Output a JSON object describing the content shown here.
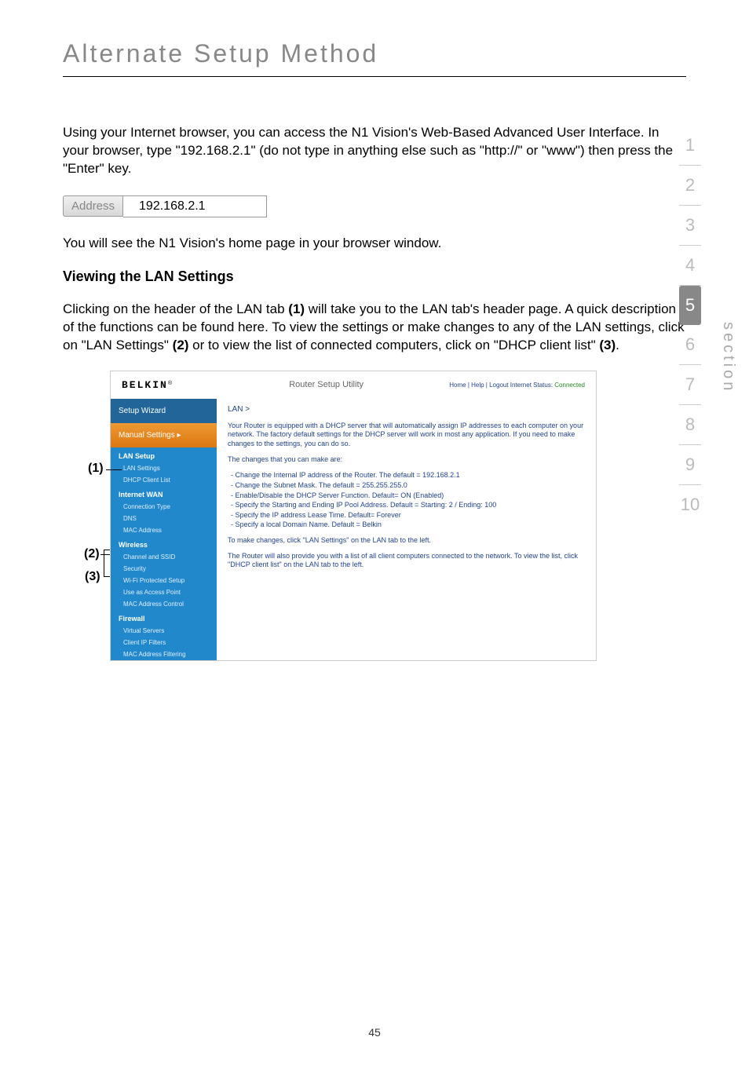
{
  "page": {
    "title": "Alternate Setup Method",
    "number": "45"
  },
  "sidenav": {
    "items": [
      "1",
      "2",
      "3",
      "4",
      "5",
      "6",
      "7",
      "8",
      "9",
      "10"
    ],
    "active_index": 4,
    "label": "section"
  },
  "intro_paragraph": "Using your Internet browser, you can access the N1 Vision's Web-Based Advanced User Interface. In your browser, type \"192.168.2.1\" (do not type in anything else such as \"http://\" or \"www\") then press the \"Enter\" key.",
  "address_bar": {
    "label": "Address",
    "value": "192.168.2.1"
  },
  "after_address": "You will see the N1 Vision's home page in your browser window.",
  "section": {
    "heading": "Viewing the LAN Settings",
    "body_part1": "Clicking on the header of the LAN tab ",
    "b1": "(1)",
    "body_part2": " will take you to the LAN tab's header page. A quick description of the functions can be found here. To view the settings or make changes to any of the LAN settings, click on \"LAN Settings\" ",
    "b2": "(2)",
    "body_part3": " or to view the list of connected computers, click on \"DHCP client list\" ",
    "b3": "(3)",
    "body_part4": "."
  },
  "callouts": {
    "c1": "(1)",
    "c2": "(2)",
    "c3": "(3)"
  },
  "router": {
    "logo": "BELKIN",
    "logo_suffix": "®",
    "utility_title": "Router Setup Utility",
    "header_links": "Home | Help | Logout   Internet Status:",
    "status": "Connected",
    "nav": {
      "wizard": "Setup Wizard",
      "manual": "Manual Settings",
      "sections": [
        {
          "title": "LAN Setup",
          "items": [
            "LAN Settings",
            "DHCP Client List"
          ]
        },
        {
          "title": "Internet WAN",
          "items": [
            "Connection Type",
            "DNS",
            "MAC Address"
          ]
        },
        {
          "title": "Wireless",
          "items": [
            "Channel and SSID",
            "Security",
            "Wi-Fi Protected Setup",
            "Use as Access Point",
            "MAC Address Control"
          ]
        },
        {
          "title": "Firewall",
          "items": [
            "Virtual Servers",
            "Client IP Filters",
            "MAC Address Filtering"
          ]
        }
      ]
    },
    "content": {
      "breadcrumb": "LAN >",
      "p1": "Your Router is equipped with a DHCP server that will automatically assign IP addresses to each computer on your network. The factory default settings for the DHCP server will work in most any application. If you need to make changes to the settings, you can do so.",
      "p2": "The changes that you can make are:",
      "bullets": [
        "- Change the Internal IP address of the Router. The default = 192.168.2.1",
        "- Change the Subnet Mask. The default = 255.255.255.0",
        "- Enable/Disable the DHCP Server Function. Default= ON (Enabled)",
        "- Specify the Starting and Ending IP Pool Address. Default = Starting: 2 / Ending: 100",
        "- Specify the IP address Lease Time. Default= Forever",
        "- Specify a local Domain Name. Default = Belkin"
      ],
      "p3": "To make changes, click \"LAN Settings\" on the LAN tab to the left.",
      "p4": "The Router will also provide you with a list of all client computers connected to the network. To view the list, click \"DHCP client list\" on the LAN tab to the left."
    }
  }
}
